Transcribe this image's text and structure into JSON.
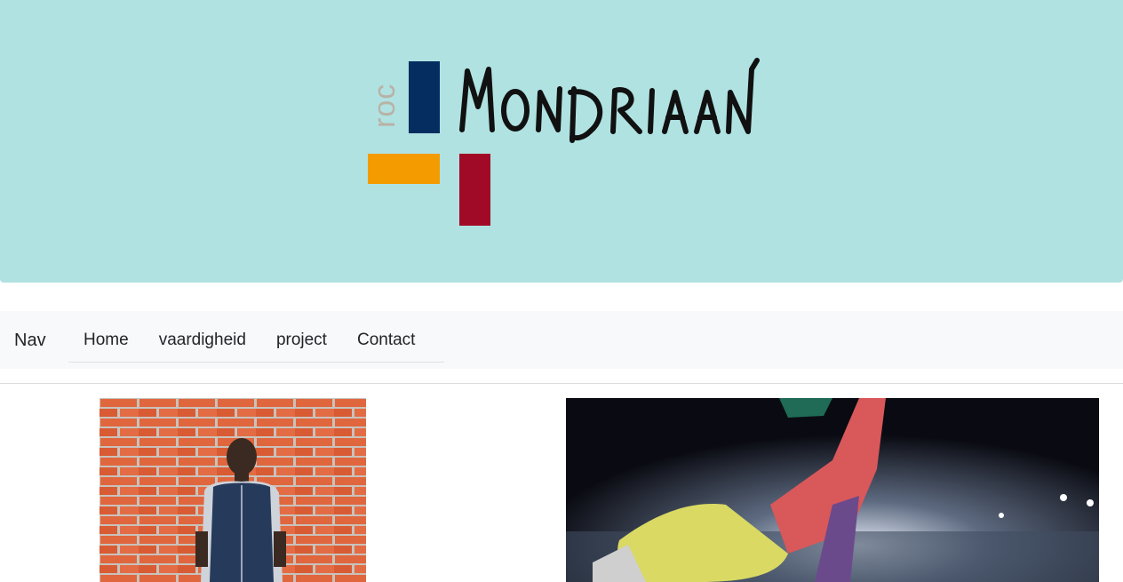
{
  "header": {
    "logo": {
      "prefix": "roc",
      "name": "MONDRIAAN",
      "colors": {
        "blue": "#062d60",
        "orange": "#f49b00",
        "red": "#a10a26"
      }
    },
    "background": "#b0e2e2"
  },
  "nav": {
    "brand": "Nav",
    "items": [
      {
        "label": "Home"
      },
      {
        "label": "vaardigheid"
      },
      {
        "label": "project"
      },
      {
        "label": "Contact"
      }
    ]
  },
  "content": {
    "images": [
      {
        "name": "portrait-photo",
        "description": "person in front of brick wall"
      },
      {
        "name": "football-boot-photo",
        "description": "football player's leg in stadium"
      }
    ]
  }
}
